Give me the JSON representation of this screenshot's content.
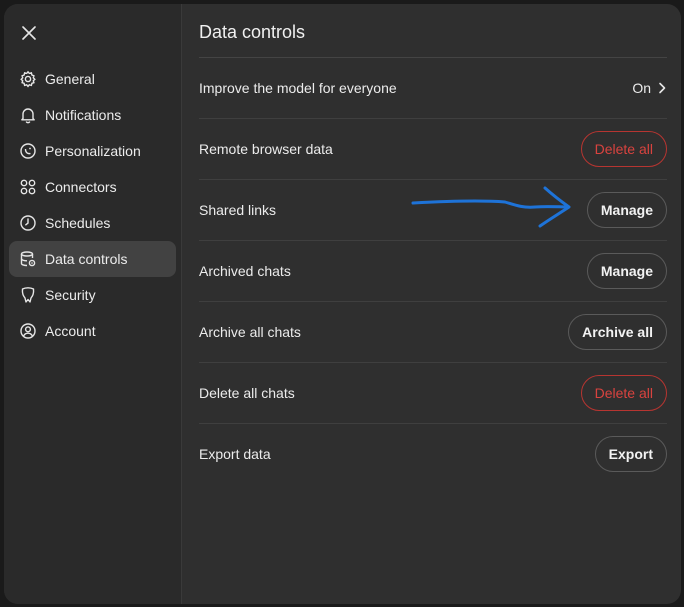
{
  "sidebar": {
    "close_icon": "close-icon",
    "items": [
      {
        "label": "General",
        "icon": "gear-icon"
      },
      {
        "label": "Notifications",
        "icon": "bell-icon"
      },
      {
        "label": "Personalization",
        "icon": "personalization-icon"
      },
      {
        "label": "Connectors",
        "icon": "connectors-icon"
      },
      {
        "label": "Schedules",
        "icon": "clock-icon"
      },
      {
        "label": "Data controls",
        "icon": "database-icon",
        "active": true
      },
      {
        "label": "Security",
        "icon": "shield-icon"
      },
      {
        "label": "Account",
        "icon": "user-circle-icon"
      }
    ]
  },
  "main": {
    "title": "Data controls",
    "rows": [
      {
        "label": "Improve the model for everyone",
        "value": "On"
      },
      {
        "label": "Remote browser data",
        "button": "Delete all"
      },
      {
        "label": "Shared links",
        "button": "Manage"
      },
      {
        "label": "Archived chats",
        "button": "Manage"
      },
      {
        "label": "Archive all chats",
        "button": "Archive all"
      },
      {
        "label": "Delete all chats",
        "button": "Delete all"
      },
      {
        "label": "Export data",
        "button": "Export"
      }
    ]
  },
  "colors": {
    "modal_bg": "#2f2f2f",
    "sidebar_bg": "#2a2a2a",
    "active_item_bg": "#424242",
    "danger": "#d9433f",
    "annotation_arrow": "#1e73d8"
  }
}
